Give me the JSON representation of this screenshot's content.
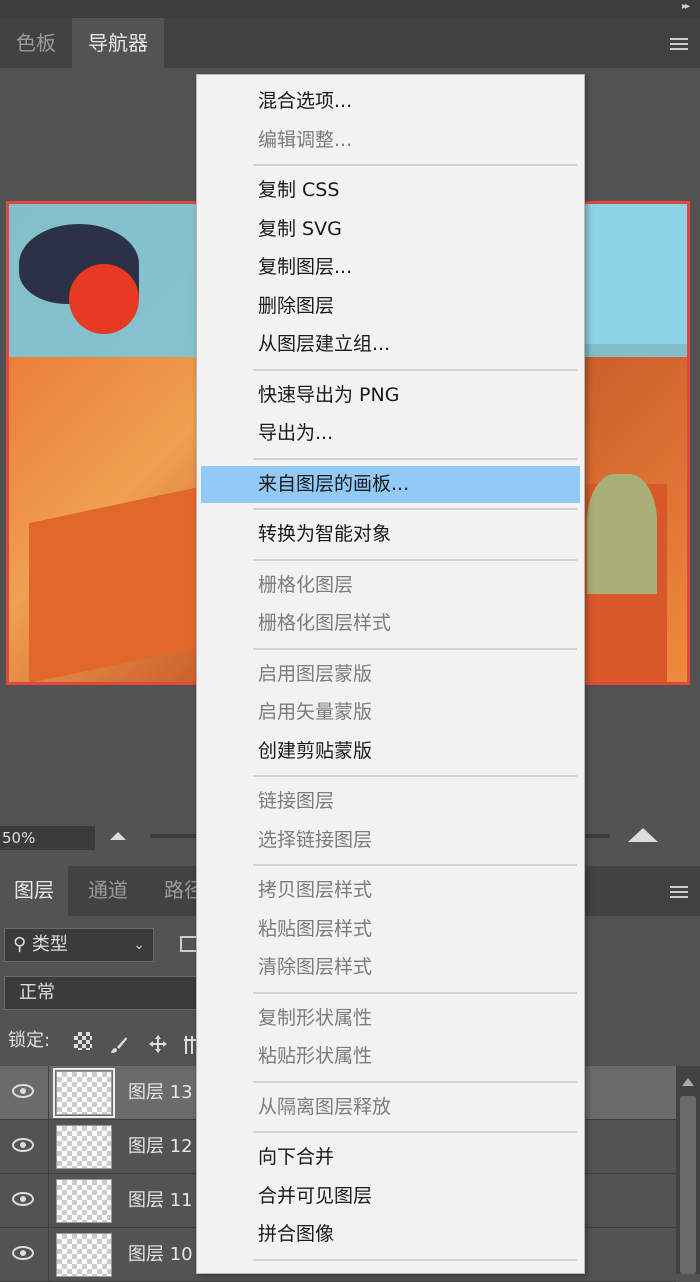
{
  "top_panel": {
    "tabs": [
      "色板",
      "导航器"
    ],
    "active_tab": 1
  },
  "navigator": {
    "zoom": "50%"
  },
  "layers_panel": {
    "tabs": [
      "图层",
      "通道",
      "路径"
    ],
    "filter": "类型",
    "blend_mode": "正常",
    "lock_label": "锁定:",
    "layers": [
      {
        "name": "图层 13",
        "selected": true
      },
      {
        "name": "图层 12",
        "selected": false
      },
      {
        "name": "图层 11",
        "selected": false
      },
      {
        "name": "图层 10",
        "selected": false
      }
    ]
  },
  "context_menu": {
    "items": [
      {
        "label": "混合选项...",
        "enabled": true
      },
      {
        "label": "编辑调整...",
        "enabled": false
      },
      {
        "separator": true
      },
      {
        "label": "复制 CSS",
        "enabled": true
      },
      {
        "label": "复制 SVG",
        "enabled": true
      },
      {
        "label": "复制图层...",
        "enabled": true
      },
      {
        "label": "删除图层",
        "enabled": true
      },
      {
        "label": "从图层建立组...",
        "enabled": true
      },
      {
        "separator": true
      },
      {
        "label": "快速导出为 PNG",
        "enabled": true
      },
      {
        "label": "导出为...",
        "enabled": true
      },
      {
        "separator": true
      },
      {
        "label": "来自图层的画板...",
        "enabled": true,
        "highlighted": true
      },
      {
        "separator": true
      },
      {
        "label": "转换为智能对象",
        "enabled": true
      },
      {
        "separator": true
      },
      {
        "label": "栅格化图层",
        "enabled": false
      },
      {
        "label": "栅格化图层样式",
        "enabled": false
      },
      {
        "separator": true
      },
      {
        "label": "启用图层蒙版",
        "enabled": false
      },
      {
        "label": "启用矢量蒙版",
        "enabled": false
      },
      {
        "label": "创建剪贴蒙版",
        "enabled": true
      },
      {
        "separator": true
      },
      {
        "label": "链接图层",
        "enabled": false
      },
      {
        "label": "选择链接图层",
        "enabled": false
      },
      {
        "separator": true
      },
      {
        "label": "拷贝图层样式",
        "enabled": false
      },
      {
        "label": "粘贴图层样式",
        "enabled": false
      },
      {
        "label": "清除图层样式",
        "enabled": false
      },
      {
        "separator": true
      },
      {
        "label": "复制形状属性",
        "enabled": false
      },
      {
        "label": "粘贴形状属性",
        "enabled": false
      },
      {
        "separator": true
      },
      {
        "label": "从隔离图层释放",
        "enabled": false
      },
      {
        "separator": true
      },
      {
        "label": "向下合并",
        "enabled": true
      },
      {
        "label": "合并可见图层",
        "enabled": true
      },
      {
        "label": "拼合图像",
        "enabled": true
      },
      {
        "separator": true
      }
    ]
  },
  "colors": {
    "panel_bg": "#535353",
    "tab_bar_bg": "#424242",
    "menu_bg": "#f2f2f2",
    "menu_highlight": "#91c9f7",
    "preview_border": "#e04a3e"
  }
}
